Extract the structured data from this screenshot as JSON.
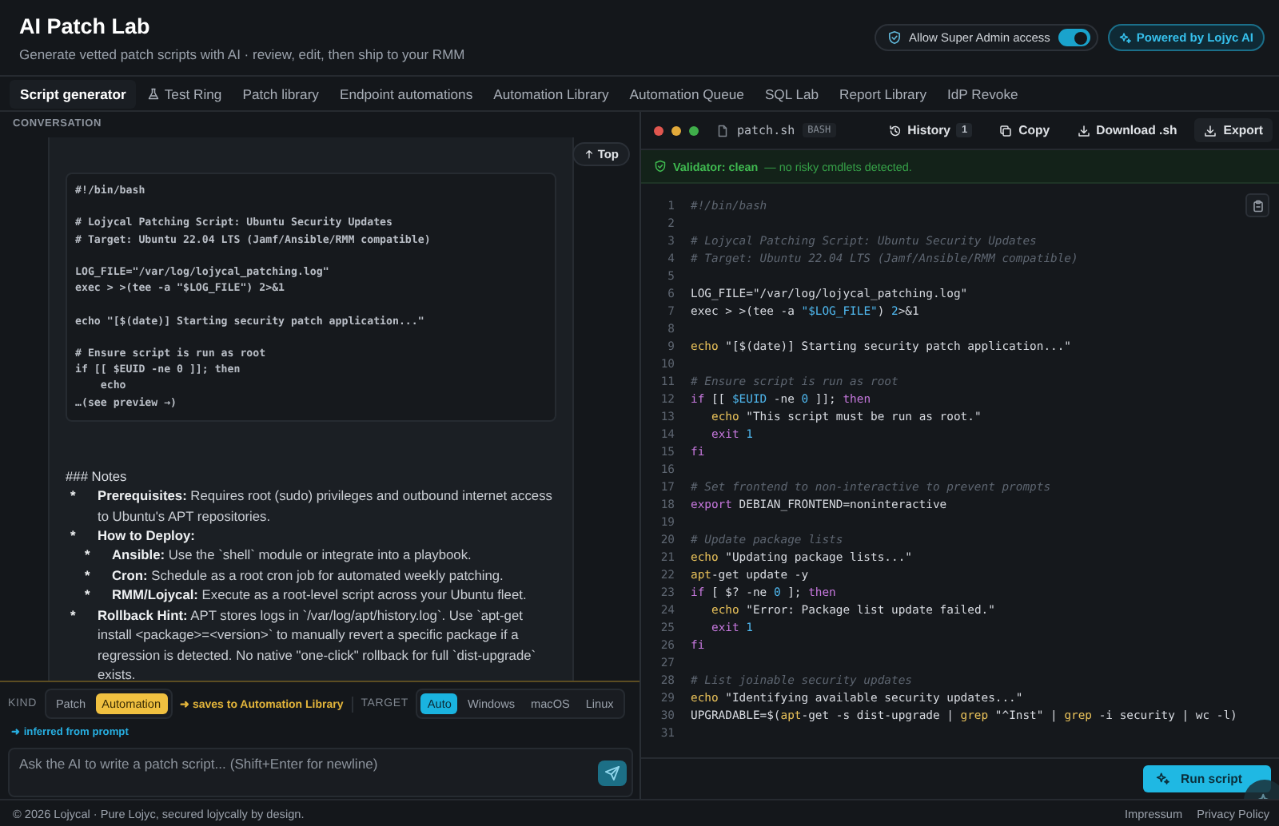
{
  "header": {
    "title": "AI Patch Lab",
    "subtitle": "Generate vetted patch scripts with AI · review, edit, then ship to your RMM",
    "admin_toggle": {
      "label": "Allow Super Admin access",
      "on": true
    },
    "badge": "Powered by Lojyc AI"
  },
  "tabs": [
    {
      "label": "Script generator",
      "selected": true
    },
    {
      "label": "Test Ring",
      "selected": false,
      "icon": true
    },
    {
      "label": "Patch library",
      "selected": false
    },
    {
      "label": "Endpoint automations",
      "selected": false
    },
    {
      "label": "Automation Library",
      "selected": false
    },
    {
      "label": "Automation Queue",
      "selected": false
    },
    {
      "label": "SQL Lab",
      "selected": false
    },
    {
      "label": "Report Library",
      "selected": false
    },
    {
      "label": "IdP Revoke",
      "selected": false
    }
  ],
  "conversation": {
    "label": "CONVERSATION",
    "top_button": "Top",
    "code_block": "#!/bin/bash\n\n# Lojycal Patching Script: Ubuntu Security Updates\n# Target: Ubuntu 22.04 LTS (Jamf/Ansible/RMM compatible)\n\nLOG_FILE=\"/var/log/lojycal_patching.log\"\nexec > >(tee -a \"$LOG_FILE\") 2>&1\n\necho \"[$(date)] Starting security patch application...\"\n\n# Ensure script is run as root\nif [[ $EUID -ne 0 ]]; then\n    echo\n…(see preview →)",
    "notes": {
      "heading": "### Notes",
      "items": [
        {
          "marker": "*",
          "text": "**Prerequisites:** Requires root (sudo) privileges and outbound internet access to Ubuntu's APT repositories."
        },
        {
          "marker": "*",
          "text": "**How to Deploy:**",
          "children": [
            {
              "marker": "*",
              "text": "**Ansible:** Use the `shell` module or integrate into a playbook."
            },
            {
              "marker": "*",
              "text": "**Cron:** Schedule as a root cron job for automated weekly patching."
            },
            {
              "marker": "*",
              "text": "**RMM/Lojycal:** Execute as a root-level script across your Ubuntu fleet."
            }
          ]
        },
        {
          "marker": "*",
          "text": "**Rollback Hint:** APT stores logs in `/var/log/apt/history.log`. Use `apt-get install <package>=<version>` to manually revert a specific package if a regression is detected. No native \"one-click\" rollback for full `dist-upgrade` exists."
        }
      ]
    }
  },
  "composer": {
    "kind_label": "KIND",
    "kinds": [
      {
        "label": "Patch",
        "selected": false
      },
      {
        "label": "Automation",
        "selected": true
      }
    ],
    "kind_hint": "➜ saves to Automation Library",
    "target_label": "TARGET",
    "targets": [
      {
        "label": "Auto",
        "selected": true
      },
      {
        "label": "Windows",
        "selected": false
      },
      {
        "label": "macOS",
        "selected": false
      },
      {
        "label": "Linux",
        "selected": false
      }
    ],
    "inferred": "➜ inferred from prompt",
    "input": {
      "placeholder": "Ask the AI to write a patch script... (Shift+Enter for newline)"
    }
  },
  "editor": {
    "filename": "patch.sh",
    "language": "BASH",
    "actions": [
      {
        "kind": "history",
        "label": "History",
        "count": "1"
      },
      {
        "kind": "copy",
        "label": "Copy"
      },
      {
        "kind": "download",
        "label": "Download .sh"
      },
      {
        "kind": "export",
        "label": "Export"
      }
    ],
    "validator": {
      "status": "Validator: clean",
      "message": "— no risky cmdlets detected."
    },
    "lines": [
      {
        "num": "1",
        "seg": [
          {
            "kind": "comment",
            "text": "#!/bin/bash"
          }
        ]
      },
      {
        "num": "2"
      },
      {
        "num": "3",
        "seg": [
          {
            "kind": "comment",
            "text": "# Lojycal Patching Script: Ubuntu Security Updates"
          }
        ]
      },
      {
        "num": "4",
        "seg": [
          {
            "kind": "comment",
            "text": "# Target: Ubuntu 22.04 LTS (Jamf/Ansible/RMM compatible)"
          }
        ]
      },
      {
        "num": "5"
      },
      {
        "num": "6",
        "seg": [
          {
            "kind": "plain",
            "text": "LOG_FILE="
          },
          {
            "kind": "string",
            "text": "\"/var/log/lojycal_patching.log\""
          }
        ]
      },
      {
        "num": "7",
        "seg": [
          {
            "kind": "plain",
            "text": "exec > >(tee -a "
          },
          {
            "kind": "variable",
            "text": "\"$LOG_FILE\""
          },
          {
            "kind": "plain",
            "text": ") "
          },
          {
            "kind": "number",
            "text": "2"
          },
          {
            "kind": "plain",
            "text": ">&1"
          }
        ]
      },
      {
        "num": "8"
      },
      {
        "num": "9",
        "seg": [
          {
            "kind": "builtin",
            "text": "echo"
          },
          {
            "kind": "string",
            "text": " \"[$(date)] Starting security patch application...\""
          }
        ]
      },
      {
        "num": "10"
      },
      {
        "num": "11",
        "seg": [
          {
            "kind": "comment",
            "text": "# Ensure script is run as root"
          }
        ]
      },
      {
        "num": "12",
        "seg": [
          {
            "kind": "keyword",
            "text": "if"
          },
          {
            "kind": "plain",
            "text": " [[ "
          },
          {
            "kind": "variable",
            "text": "$EUID"
          },
          {
            "kind": "plain",
            "text": " -ne "
          },
          {
            "kind": "number",
            "text": "0"
          },
          {
            "kind": "plain",
            "text": " ]]; "
          },
          {
            "kind": "keyword",
            "text": "then"
          }
        ]
      },
      {
        "num": "13",
        "indented": true,
        "seg": [
          {
            "kind": "builtin",
            "text": "echo"
          },
          {
            "kind": "string",
            "text": " \"This script must be run as root.\""
          }
        ]
      },
      {
        "num": "14",
        "indented": true,
        "seg": [
          {
            "kind": "keyword",
            "text": "exit"
          },
          {
            "kind": "number",
            "text": " 1"
          }
        ]
      },
      {
        "num": "15",
        "seg": [
          {
            "kind": "keyword",
            "text": "fi"
          }
        ]
      },
      {
        "num": "16"
      },
      {
        "num": "17",
        "seg": [
          {
            "kind": "comment",
            "text": "# Set frontend to non-interactive to prevent prompts"
          }
        ]
      },
      {
        "num": "18",
        "seg": [
          {
            "kind": "keyword",
            "text": "export"
          },
          {
            "kind": "plain",
            "text": " DEBIAN_FRONTEND=noninteractive"
          }
        ]
      },
      {
        "num": "19"
      },
      {
        "num": "20",
        "seg": [
          {
            "kind": "comment",
            "text": "# Update package lists"
          }
        ]
      },
      {
        "num": "21",
        "seg": [
          {
            "kind": "builtin",
            "text": "echo"
          },
          {
            "kind": "string",
            "text": " \"Updating package lists...\""
          }
        ]
      },
      {
        "num": "22",
        "seg": [
          {
            "kind": "builtin",
            "text": "apt"
          },
          {
            "kind": "plain",
            "text": "-get update -y"
          }
        ]
      },
      {
        "num": "23",
        "seg": [
          {
            "kind": "keyword",
            "text": "if"
          },
          {
            "kind": "plain",
            "text": " [ $? -ne "
          },
          {
            "kind": "number",
            "text": "0"
          },
          {
            "kind": "plain",
            "text": " ]; "
          },
          {
            "kind": "keyword",
            "text": "then"
          }
        ]
      },
      {
        "num": "24",
        "indented": true,
        "seg": [
          {
            "kind": "builtin",
            "text": "echo"
          },
          {
            "kind": "string",
            "text": " \"Error: Package list update failed.\""
          }
        ]
      },
      {
        "num": "25",
        "indented": true,
        "seg": [
          {
            "kind": "keyword",
            "text": "exit"
          },
          {
            "kind": "number",
            "text": " 1"
          }
        ]
      },
      {
        "num": "26",
        "seg": [
          {
            "kind": "keyword",
            "text": "fi"
          }
        ]
      },
      {
        "num": "27"
      },
      {
        "num": "28",
        "seg": [
          {
            "kind": "comment",
            "text": "# List joinable security updates"
          }
        ]
      },
      {
        "num": "29",
        "seg": [
          {
            "kind": "builtin",
            "text": "echo"
          },
          {
            "kind": "string",
            "text": " \"Identifying available security updates...\""
          }
        ]
      },
      {
        "num": "30",
        "seg": [
          {
            "kind": "plain",
            "text": "UPGRADABLE=$("
          },
          {
            "kind": "builtin",
            "text": "apt"
          },
          {
            "kind": "plain",
            "text": "-get -s dist-upgrade | "
          },
          {
            "kind": "builtin",
            "text": "grep"
          },
          {
            "kind": "string",
            "text": " \"^Inst\""
          },
          {
            "kind": "plain",
            "text": " | "
          },
          {
            "kind": "builtin",
            "text": "grep"
          },
          {
            "kind": "plain",
            "text": " -i security | wc -l)"
          }
        ]
      },
      {
        "num": "31"
      }
    ],
    "run_button": "Run script"
  },
  "footer": {
    "copyright": "© 2026 Lojycal · Pure Lojyc, secured lojycally by design.",
    "links": [
      "Impressum",
      "Privacy Policy"
    ]
  }
}
